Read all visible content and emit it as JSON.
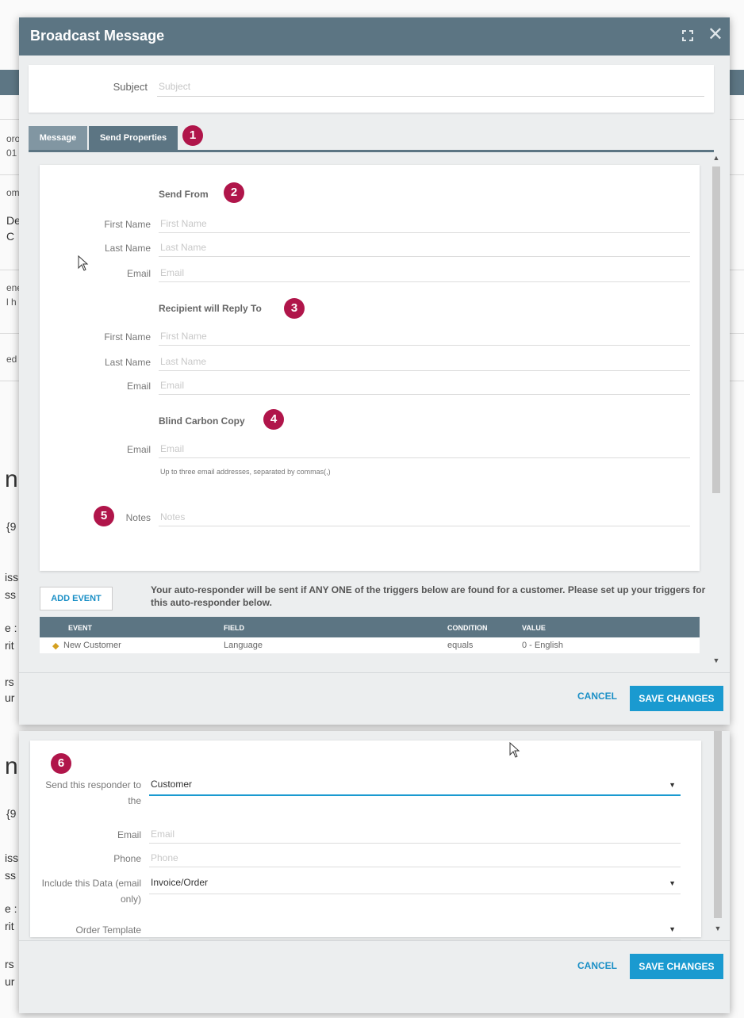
{
  "modal": {
    "title": "Broadcast Message",
    "subject": {
      "label": "Subject",
      "placeholder": "Subject"
    },
    "tabs": [
      {
        "label": "Message"
      },
      {
        "label": "Send Properties"
      }
    ],
    "badges": [
      "1",
      "2",
      "3",
      "4",
      "5",
      "6"
    ],
    "send_from": {
      "heading": "Send From",
      "first_name": {
        "label": "First Name",
        "placeholder": "First Name"
      },
      "last_name": {
        "label": "Last Name",
        "placeholder": "Last Name"
      },
      "email": {
        "label": "Email",
        "placeholder": "Email"
      }
    },
    "reply_to": {
      "heading": "Recipient will Reply To",
      "first_name": {
        "label": "First Name",
        "placeholder": "First Name"
      },
      "last_name": {
        "label": "Last Name",
        "placeholder": "Last Name"
      },
      "email": {
        "label": "Email",
        "placeholder": "Email"
      }
    },
    "bcc": {
      "heading": "Blind Carbon Copy",
      "email": {
        "label": "Email",
        "placeholder": "Email"
      },
      "hint": "Up to three email addresses, separated by commas(,)"
    },
    "notes": {
      "label": "Notes",
      "placeholder": "Notes"
    },
    "add_event": "ADD EVENT",
    "event_info": "Your auto-responder will be sent if ANY ONE of the triggers below are found for a customer. Please set up your triggers for this auto-responder below.",
    "event_table": {
      "headers": [
        "EVENT",
        "FIELD",
        "CONDITION",
        "VALUE"
      ],
      "row": [
        "New Customer",
        "Language",
        "equals",
        "0 - English"
      ]
    },
    "footer": {
      "cancel": "CANCEL",
      "save": "SAVE CHANGES"
    }
  },
  "panel2": {
    "send_to": {
      "label": "Send this responder to the",
      "value": "Customer"
    },
    "email": {
      "label": "Email",
      "placeholder": "Email"
    },
    "phone": {
      "label": "Phone",
      "placeholder": "Phone"
    },
    "include_data": {
      "label": "Include this Data (email only)",
      "value": "Invoice/Order"
    },
    "order_template": {
      "label": "Order Template",
      "value": ""
    },
    "footer": {
      "cancel": "CANCEL",
      "save": "SAVE CHANGES"
    }
  },
  "background": {
    "fragments": [
      "oro",
      "01",
      "om",
      "De",
      "C",
      "ene",
      "l h",
      "ed",
      "n",
      "{9",
      "iss",
      "ss",
      "e :",
      "rit",
      "rs",
      "ur",
      "n",
      "{9",
      "iss",
      "ss",
      "e :",
      "rit",
      "rs",
      "ur"
    ]
  },
  "colors": {
    "header": "#5c7583",
    "accent": "#1a9ad0",
    "badge": "#b0154a"
  }
}
